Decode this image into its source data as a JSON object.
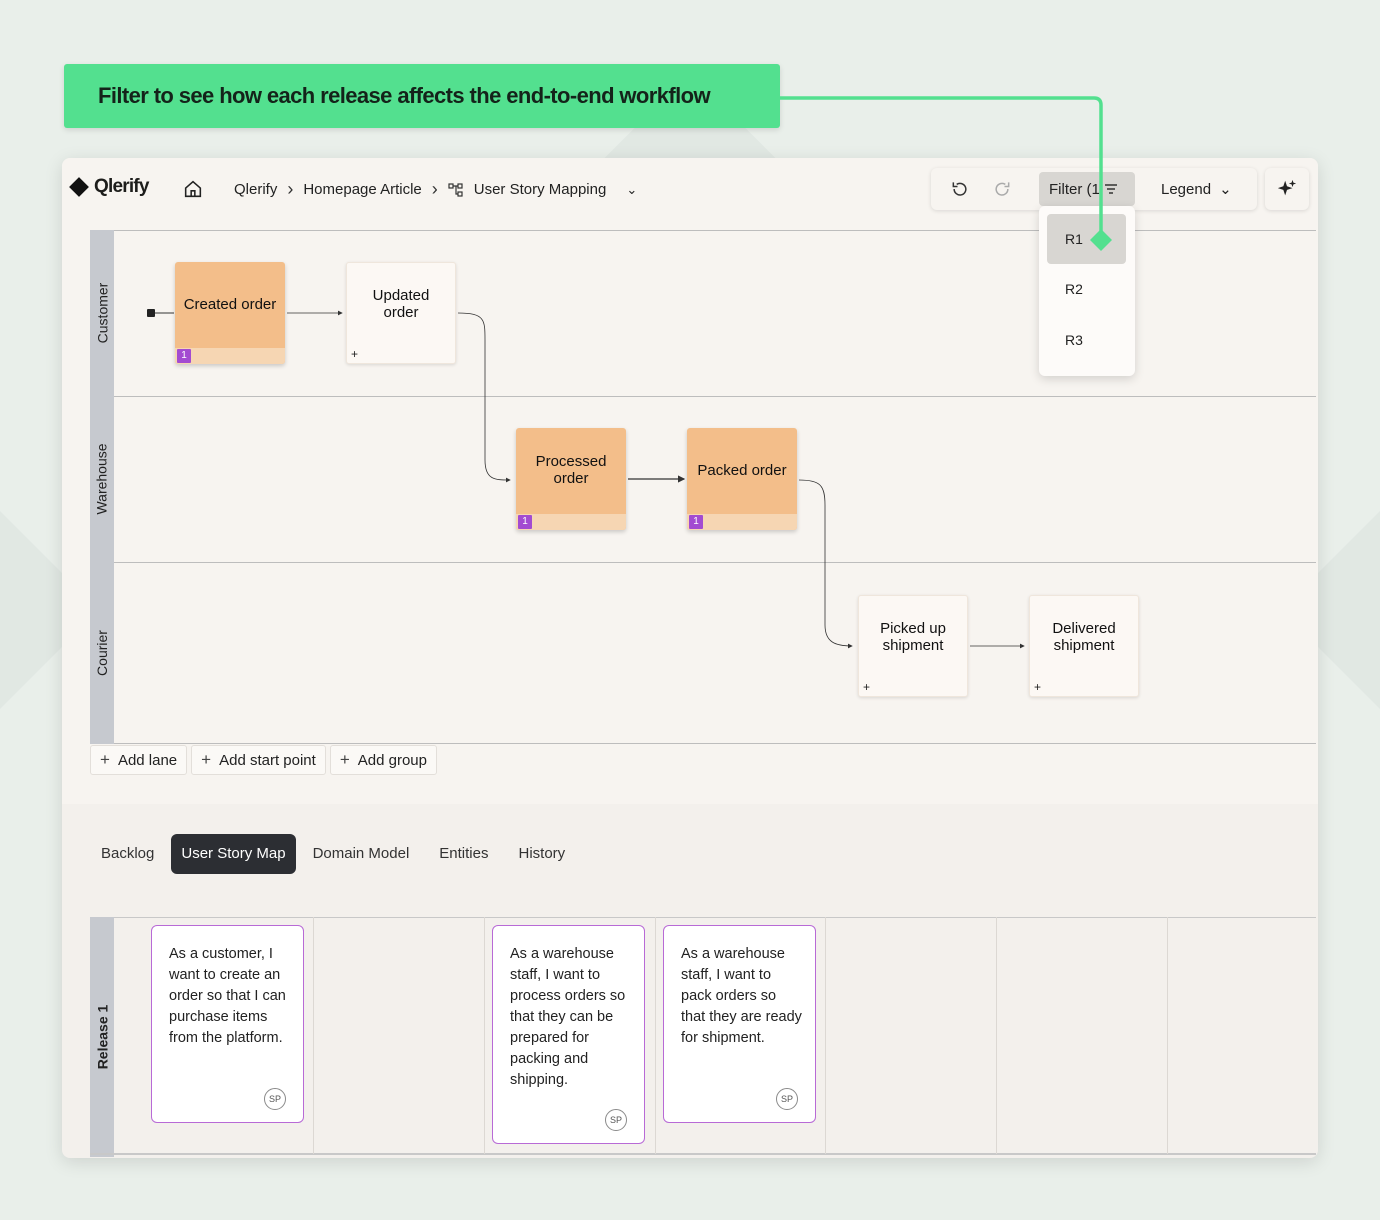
{
  "callout": {
    "text": "Filter to see how each release affects the end-to-end workflow",
    "color": "#53e08f"
  },
  "app": {
    "logo": "Qlerify",
    "breadcrumb": {
      "root": "Qlerify",
      "project": "Homepage Article",
      "view": "User Story Mapping"
    },
    "toolbar": {
      "filter_label": "Filter (1",
      "legend_label": "Legend"
    },
    "filter_options": [
      "R1",
      "R2",
      "R3"
    ],
    "filter_selected": "R1"
  },
  "lanes": [
    {
      "label": "Customer"
    },
    {
      "label": "Warehouse"
    },
    {
      "label": "Courier"
    }
  ],
  "nodes": [
    {
      "label": "Created order",
      "lane": "Customer",
      "filled": true,
      "badge": "1"
    },
    {
      "label": "Updated order",
      "lane": "Customer",
      "filled": false,
      "badge": "+"
    },
    {
      "label": "Processed order",
      "lane": "Warehouse",
      "filled": true,
      "badge": "1"
    },
    {
      "label": "Packed order",
      "lane": "Warehouse",
      "filled": true,
      "badge": "1"
    },
    {
      "label": "Picked up shipment",
      "lane": "Courier",
      "filled": false,
      "badge": "+"
    },
    {
      "label": "Delivered shipment",
      "lane": "Courier",
      "filled": false,
      "badge": "+"
    }
  ],
  "actions": {
    "add_lane": "Add lane",
    "add_start_point": "Add start point",
    "add_group": "Add group"
  },
  "tabs": [
    "Backlog",
    "User Story Map",
    "Domain Model",
    "Entities",
    "History"
  ],
  "active_tab": "User Story Map",
  "release": {
    "label": "Release 1",
    "stories": [
      {
        "text": "As a customer, I want to create an order so that I can purchase items from the platform.",
        "points": "SP"
      },
      {
        "text": "As a warehouse staff, I want to process orders so that they can be prepared for packing and shipping.",
        "points": "SP"
      },
      {
        "text": "As a warehouse staff, I want to pack orders so that they are ready for shipment.",
        "points": "SP"
      }
    ]
  },
  "colors": {
    "node_fill": "#f3be8a",
    "badge": "#a34bd1",
    "story_border": "#b86ad6",
    "accent_green": "#53e08f"
  }
}
